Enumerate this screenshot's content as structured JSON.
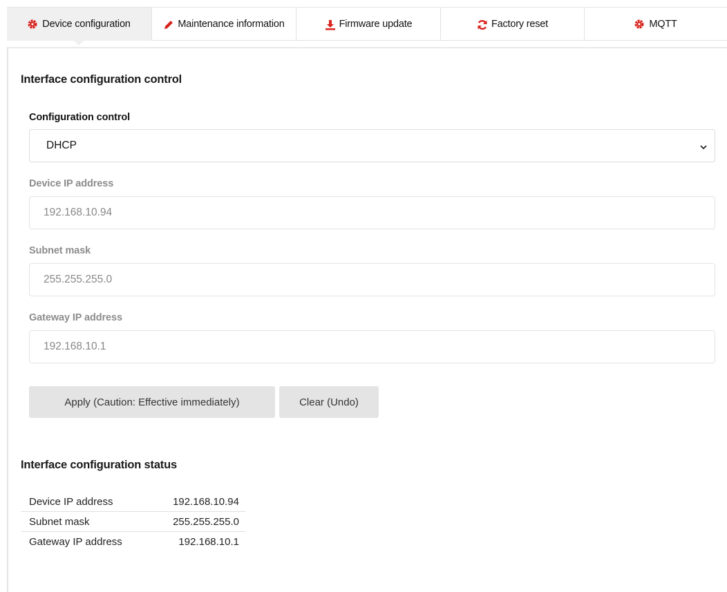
{
  "tabs": [
    {
      "label": "Device configuration",
      "icon": "gear-icon",
      "active": true
    },
    {
      "label": "Maintenance information",
      "icon": "pencil-icon",
      "active": false
    },
    {
      "label": "Firmware update",
      "icon": "download-icon",
      "active": false
    },
    {
      "label": "Factory reset",
      "icon": "refresh-icon",
      "active": false
    },
    {
      "label": "MQTT",
      "icon": "gear-icon",
      "active": false
    }
  ],
  "accent_color": "#d9231d",
  "config": {
    "section_title": "Interface configuration control",
    "control_label": "Configuration control",
    "control_value": "DHCP",
    "ip_label": "Device IP address",
    "ip_value": "192.168.10.94",
    "subnet_label": "Subnet mask",
    "subnet_value": "255.255.255.0",
    "gateway_label": "Gateway IP address",
    "gateway_value": "192.168.10.1",
    "apply_label": "Apply (Caution: Effective immediately)",
    "clear_label": "Clear (Undo)"
  },
  "status": {
    "section_title": "Interface configuration status",
    "rows": [
      {
        "key": "Device IP address",
        "value": "192.168.10.94"
      },
      {
        "key": "Subnet mask",
        "value": "255.255.255.0"
      },
      {
        "key": "Gateway IP address",
        "value": "192.168.10.1"
      }
    ]
  }
}
